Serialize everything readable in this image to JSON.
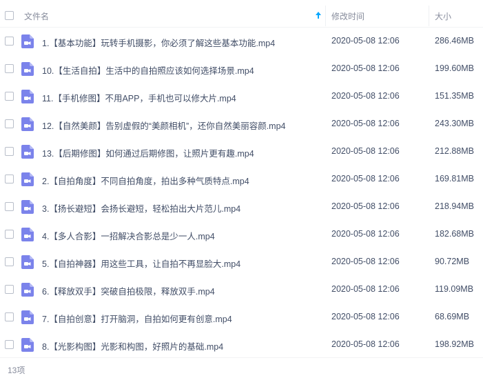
{
  "header": {
    "name_label": "文件名",
    "time_label": "修改时间",
    "size_label": "大小",
    "sort_icon": "arrow-up-icon",
    "accent_color": "#06a7ff"
  },
  "file_icon": {
    "name": "video-file-icon",
    "color": "#7b83eb"
  },
  "files": [
    {
      "name": "1.【基本功能】玩转手机摄影，你必须了解这些基本功能.mp4",
      "time": "2020-05-08 12:06",
      "size": "286.46MB"
    },
    {
      "name": "10.【生活自拍】生活中的自拍照应该如何选择场景.mp4",
      "time": "2020-05-08 12:06",
      "size": "199.60MB"
    },
    {
      "name": "11.【手机修图】不用APP，手机也可以修大片.mp4",
      "time": "2020-05-08 12:06",
      "size": "151.35MB"
    },
    {
      "name": "12.【自然美颜】告别虚假的“美颜相机”，还你自然美丽容颜.mp4",
      "time": "2020-05-08 12:06",
      "size": "243.30MB"
    },
    {
      "name": "13.【后期修图】如何通过后期修图，让照片更有趣.mp4",
      "time": "2020-05-08 12:06",
      "size": "212.88MB"
    },
    {
      "name": "2.【自拍角度】不同自拍角度，拍出多种气质特点.mp4",
      "time": "2020-05-08 12:06",
      "size": "169.81MB"
    },
    {
      "name": "3.【扬长避短】会扬长避短，轻松拍出大片范儿.mp4",
      "time": "2020-05-08 12:06",
      "size": "218.94MB"
    },
    {
      "name": "4.【多人合影】一招解决合影总是少一人.mp4",
      "time": "2020-05-08 12:06",
      "size": "182.68MB"
    },
    {
      "name": "5.【自拍神器】用这些工具，让自拍不再显脸大.mp4",
      "time": "2020-05-08 12:06",
      "size": "90.72MB"
    },
    {
      "name": "6.【释放双手】突破自拍极限，释放双手.mp4",
      "time": "2020-05-08 12:06",
      "size": "119.09MB"
    },
    {
      "name": "7.【自拍创意】打开脑洞，自拍如何更有创意.mp4",
      "time": "2020-05-08 12:06",
      "size": "68.69MB"
    },
    {
      "name": "8.【光影构图】光影和构图，好照片的基础.mp4",
      "time": "2020-05-08 12:06",
      "size": "198.92MB"
    }
  ],
  "footer": {
    "count": "13项"
  }
}
